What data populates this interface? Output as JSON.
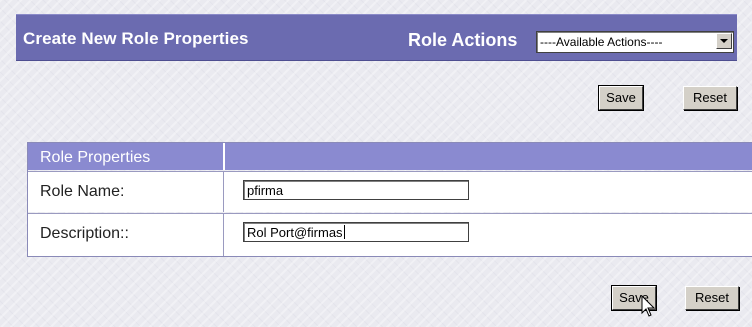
{
  "header": {
    "title": "Create New Role Properties",
    "role_actions_label": "Role Actions",
    "actions_select_value": "----Available Actions----"
  },
  "buttons": {
    "save_label": "Save",
    "reset_label": "Reset"
  },
  "properties": {
    "section_title": "Role Properties",
    "rows": [
      {
        "label": "Role Name:",
        "value": "pfirma"
      },
      {
        "label": "Description::",
        "value": "Rol Port@firmas"
      }
    ]
  },
  "colors": {
    "header_bg": "#6b6bb0",
    "section_header_bg": "#8a8ad0"
  },
  "icons": {
    "select_arrow": "chevron-down-icon",
    "cursor": "mouse-pointer-icon"
  }
}
